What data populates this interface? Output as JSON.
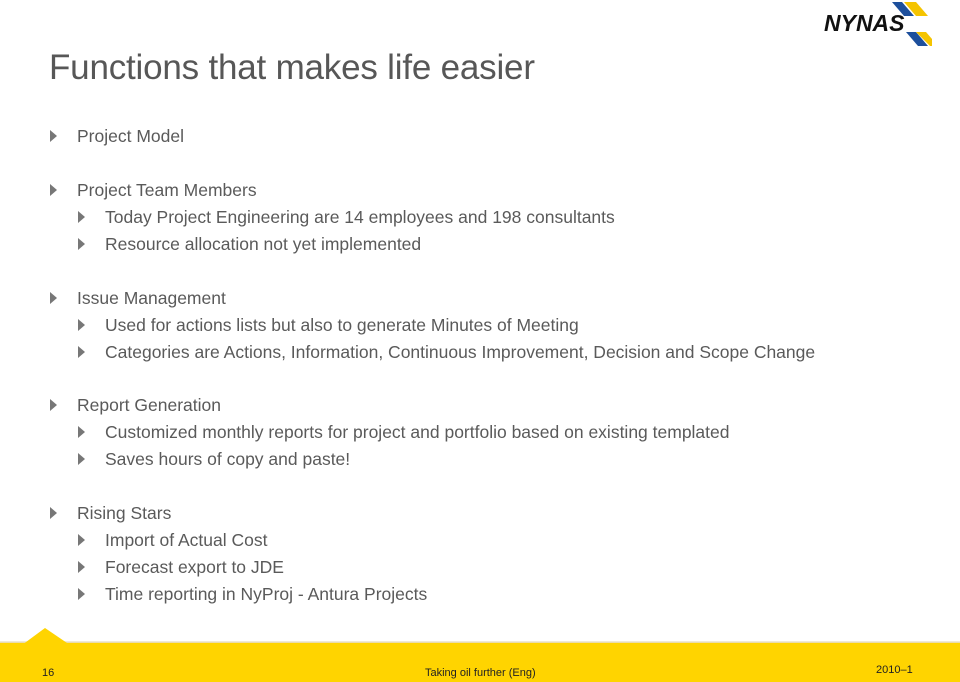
{
  "logo": {
    "text": "NYNAS",
    "colors": {
      "blue": "#1d4f9c",
      "yellow": "#f5c400",
      "text": "#111111"
    }
  },
  "title": "Functions that makes life easier",
  "sections": [
    {
      "label": "Project Model",
      "children": []
    },
    {
      "label": "Project Team Members",
      "children": [
        "Today Project Engineering are 14 employees and 198 consultants",
        "Resource allocation not yet implemented"
      ]
    },
    {
      "label": "Issue Management",
      "children": [
        "Used for actions lists but also to generate Minutes of Meeting",
        "Categories are Actions, Information, Continuous Improvement, Decision and Scope Change"
      ]
    },
    {
      "label": "Report Generation",
      "children": [
        "Customized monthly reports for project and portfolio based on existing templated",
        "Saves hours of copy and paste!"
      ]
    },
    {
      "label": "Rising Stars",
      "children": [
        "Import of Actual Cost",
        "Forecast export to JDE",
        "Time reporting in NyProj - Antura Projects"
      ]
    }
  ],
  "footer": {
    "page_number": "16",
    "center_text": "Taking oil further (Eng)",
    "version": "2010–1",
    "color": "#ffd400"
  }
}
